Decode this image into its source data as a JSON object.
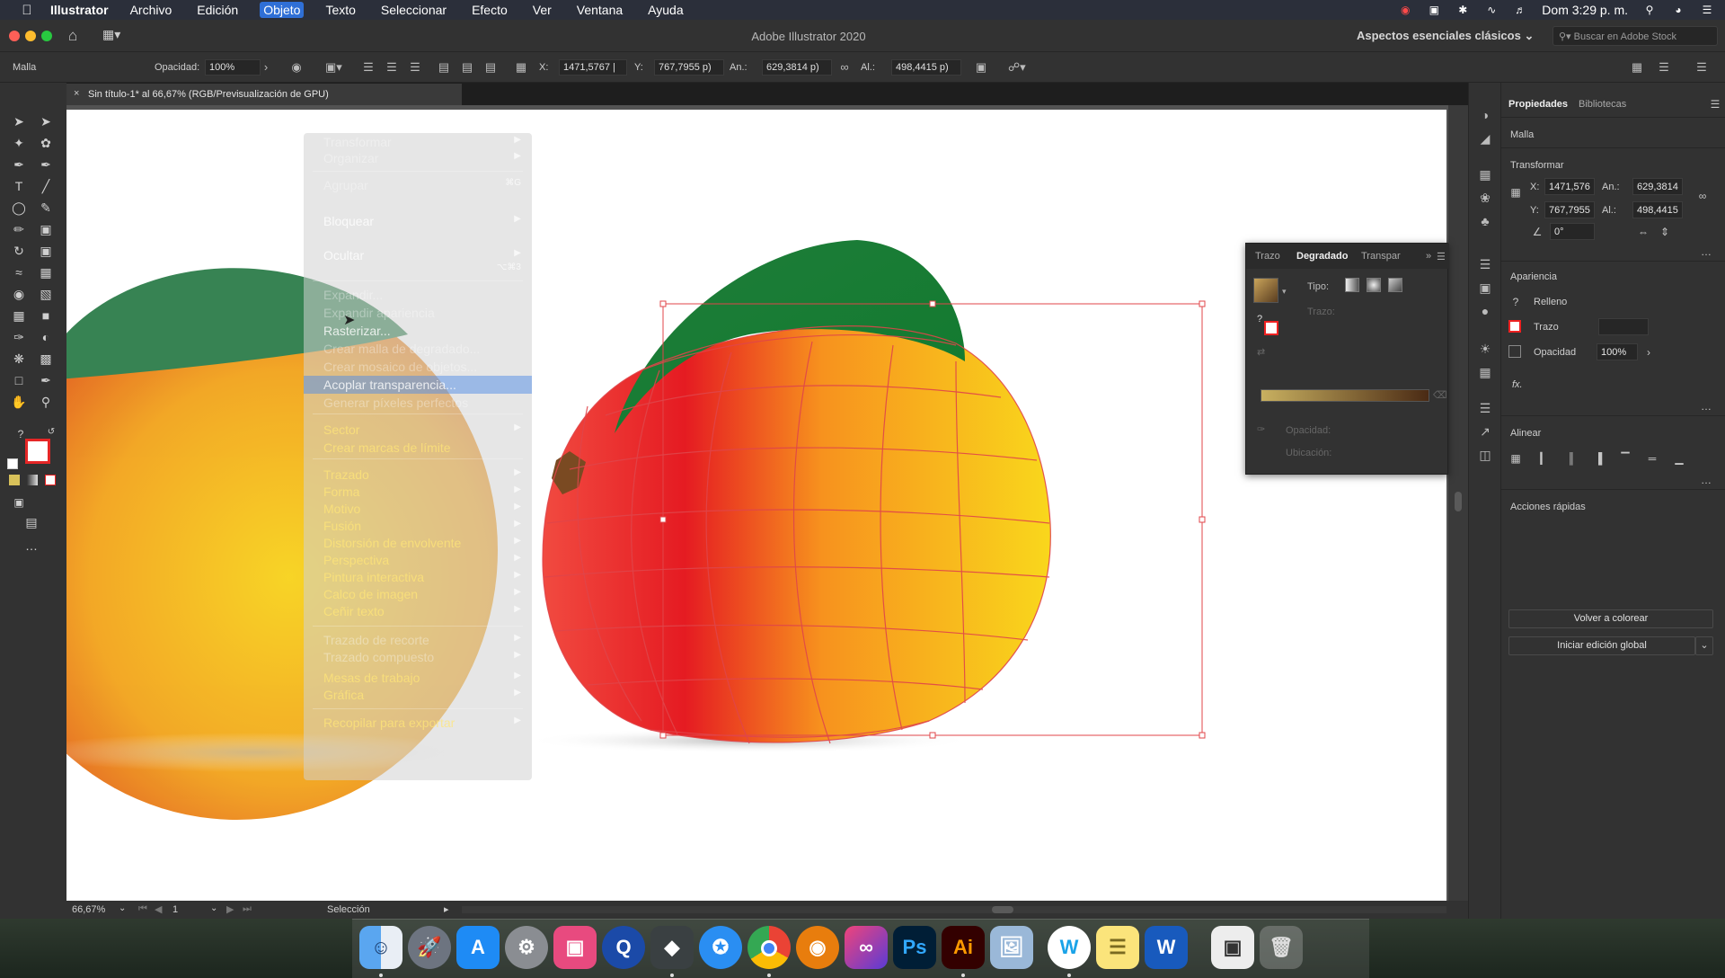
{
  "menubar": {
    "app_name": "Illustrator",
    "items": [
      "Archivo",
      "Edición",
      "Objeto",
      "Texto",
      "Seleccionar",
      "Efecto",
      "Ver",
      "Ventana",
      "Ayuda"
    ],
    "active_item": "Objeto",
    "clock": "Dom 3:29 p. m."
  },
  "titlebar": {
    "title": "Adobe Illustrator 2020",
    "workspace": "Aspectos esenciales clásicos",
    "search_placeholder": "Buscar en Adobe Stock"
  },
  "controlbar": {
    "selection_type": "Malla",
    "opacity_label": "Opacidad:",
    "opacity_value": "100%",
    "x_label": "X:",
    "x_value": "1471,5767 |",
    "y_label": "Y:",
    "y_value": "767,7955 p)",
    "w_label": "An.:",
    "w_value": "629,3814 p)",
    "h_label": "Al.:",
    "h_value": "498,4415 p)"
  },
  "document": {
    "tab_title": "Sin título-1* al 66,67% (RGB/Previsualización de GPU)"
  },
  "object_menu": {
    "items": [
      {
        "label": "Transformar",
        "state": "disabled",
        "arrow": true
      },
      {
        "label": "Organizar",
        "state": "disabled",
        "arrow": true
      },
      {
        "label": "Agrupar",
        "state": "disabled"
      },
      {
        "label": "Bloquear",
        "state": "enabled",
        "arrow": true
      },
      {
        "label": "Ocultar",
        "state": "enabled",
        "arrow": true
      },
      {
        "label": "Expandir...",
        "state": "disabled"
      },
      {
        "label": "Expandir apariencia",
        "state": "disabled"
      },
      {
        "label": "Rasterizar...",
        "state": "enabled"
      },
      {
        "label": "Crear malla de degradado...",
        "state": "disabled"
      },
      {
        "label": "Crear mosaico de objetos...",
        "state": "disabled"
      },
      {
        "label": "Acoplar transparencia...",
        "state": "highlighted"
      },
      {
        "label": "Generar píxeles perfectos",
        "state": "disabled"
      },
      {
        "label": "Sector",
        "state": "yellow",
        "arrow": true
      },
      {
        "label": "Crear marcas de límite",
        "state": "yellow"
      },
      {
        "label": "Trazado",
        "state": "yellow",
        "arrow": true
      },
      {
        "label": "Forma",
        "state": "yellow",
        "arrow": true
      },
      {
        "label": "Motivo",
        "state": "yellow",
        "arrow": true
      },
      {
        "label": "Fusión",
        "state": "yellow",
        "arrow": true
      },
      {
        "label": "Distorsión de envolvente",
        "state": "yellow",
        "arrow": true
      },
      {
        "label": "Perspectiva",
        "state": "yellow",
        "arrow": true
      },
      {
        "label": "Pintura interactiva",
        "state": "yellow",
        "arrow": true
      },
      {
        "label": "Calco de imagen",
        "state": "yellow",
        "arrow": true
      },
      {
        "label": "Ceñir texto",
        "state": "yellow",
        "arrow": true
      },
      {
        "label": "Trazado de recorte",
        "state": "disabled",
        "arrow": true
      },
      {
        "label": "Trazado compuesto",
        "state": "disabled",
        "arrow": true
      },
      {
        "label": "Mesas de trabajo",
        "state": "yellow",
        "arrow": true
      },
      {
        "label": "Gráfica",
        "state": "yellow",
        "arrow": true
      },
      {
        "label": "Recopilar para exportar",
        "state": "yellow",
        "arrow": true
      }
    ],
    "shortcut_group": "⌘G",
    "shortcut_hide": "⌥⌘3"
  },
  "statusbar": {
    "zoom": "66,67%",
    "artboard_num": "1",
    "tool": "Selección"
  },
  "gradient_panel": {
    "tabs": [
      "Trazo",
      "Degradado",
      "Transpar"
    ],
    "active_tab": "Degradado",
    "tipo_label": "Tipo:",
    "trazo_label": "Trazo:",
    "opacidad_label": "Opacidad:",
    "ubicacion_label": "Ubicación:"
  },
  "properties": {
    "tabs": [
      "Propiedades",
      "Bibliotecas"
    ],
    "active_tab": "Propiedades",
    "object_type": "Malla",
    "transform_title": "Transformar",
    "x_label": "X:",
    "x_value": "1471,576",
    "y_label": "Y:",
    "y_value": "767,7955",
    "w_label": "An.:",
    "w_value": "629,3814",
    "h_label": "Al.:",
    "h_value": "498,4415",
    "angle_value": "0°",
    "appearance_title": "Apariencia",
    "fill_label": "Relleno",
    "stroke_label": "Trazo",
    "opacity_label": "Opacidad",
    "opacity_value": "100%",
    "fx_label": "fx.",
    "align_title": "Alinear",
    "quick_actions_title": "Acciones rápidas",
    "recolor_button": "Volver a colorear",
    "global_edit_button": "Iniciar edición global"
  },
  "dock": {
    "apps": [
      "Finder",
      "Launchpad",
      "App Store",
      "Preferencias del Sistema",
      "Keynote",
      "QuickTime",
      "Filmora",
      "Safari",
      "Chrome",
      "Blender",
      "Creative Cloud",
      "Ps",
      "Ai",
      "Vista Previa",
      "Wondershare",
      "Notas",
      "Word",
      "Screenshot",
      "Papelera"
    ]
  },
  "colors": {
    "accent": "#2f6fd6",
    "mesh_line": "#e0454a",
    "leaf": "#1e8a3c",
    "mango_red": "#e8202a",
    "mango_yellow": "#f7d21a"
  }
}
